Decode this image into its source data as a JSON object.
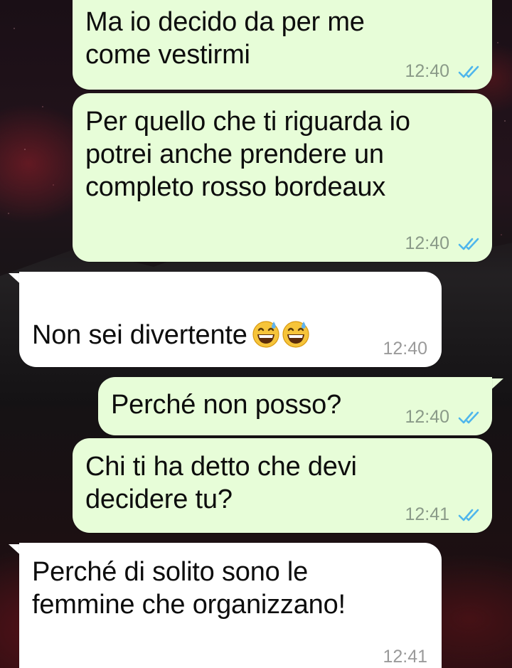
{
  "messages": [
    {
      "id": "m1",
      "direction": "out",
      "text": "Ma io decido da per me\ncome vestirmi",
      "time": "12:40",
      "status": "read"
    },
    {
      "id": "m2",
      "direction": "out",
      "text": "Per quello che ti riguarda io\npotrei anche prendere un\ncompleto rosso bordeaux",
      "time": "12:40",
      "status": "read"
    },
    {
      "id": "m3",
      "direction": "in",
      "text": "Non sei divertente",
      "emoji": [
        "grinning-face-with-sweat-emoji",
        "grinning-face-with-sweat-emoji"
      ],
      "time": "12:40"
    },
    {
      "id": "m4",
      "direction": "out",
      "text": "Perché non posso?",
      "time": "12:40",
      "status": "read"
    },
    {
      "id": "m5",
      "direction": "out",
      "text": "Chi ti ha detto che devi\ndecidere tu?",
      "time": "12:41",
      "status": "read"
    },
    {
      "id": "m6",
      "direction": "in",
      "text": "Perché di solito sono le\nfemmine che organizzano!",
      "time": "12:41"
    }
  ],
  "colors": {
    "outgoing_bubble": "#e7fdd8",
    "incoming_bubble": "#ffffff",
    "read_ticks": "#4fb6ec"
  }
}
